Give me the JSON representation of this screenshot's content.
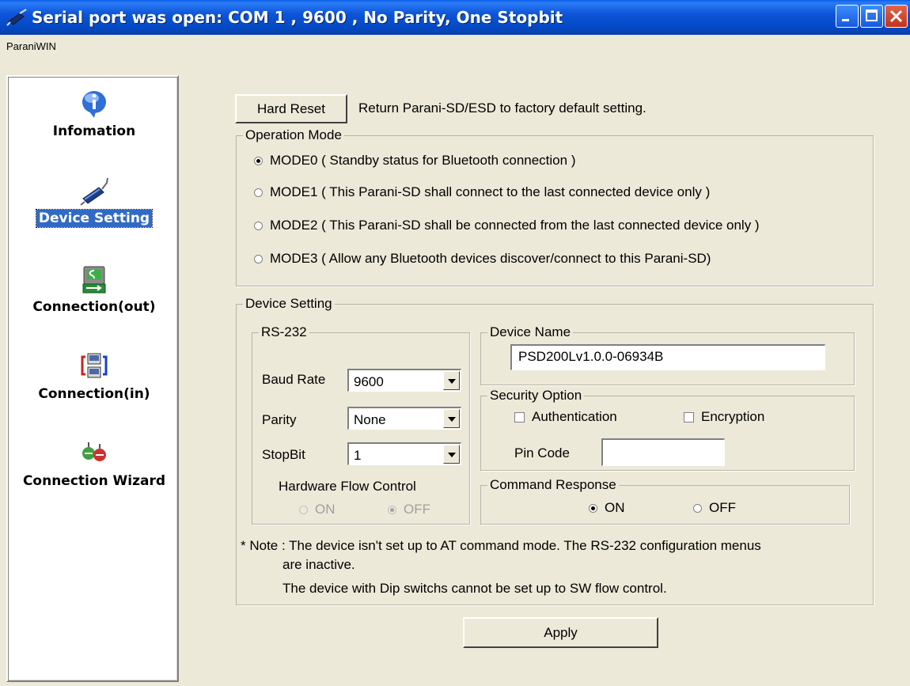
{
  "window": {
    "title": "Serial port was open: COM 1 , 9600 , No Parity, One Stopbit",
    "menu": "ParaniWIN"
  },
  "sidebar": {
    "items": [
      {
        "label": "Infomation",
        "icon": "info-icon",
        "active": false
      },
      {
        "label": "Device Setting",
        "icon": "serial-cable-icon",
        "active": true
      },
      {
        "label": "Connection(out)",
        "icon": "connection-out-icon",
        "active": false
      },
      {
        "label": "Connection(in)",
        "icon": "connection-in-icon",
        "active": false
      },
      {
        "label": "Connection Wizard",
        "icon": "wizard-icon",
        "active": false
      }
    ]
  },
  "main": {
    "hard_reset": {
      "button": "Hard Reset",
      "description": "Return Parani-SD/ESD to factory default setting."
    },
    "operation_mode": {
      "title": "Operation Mode",
      "options": [
        "MODE0 ( Standby status for Bluetooth connection )",
        "MODE1 ( This Parani-SD shall connect to the last connected device only )",
        "MODE2 ( This Parani-SD shall be connected from the last connected device only )",
        "MODE3 ( Allow any Bluetooth devices discover/connect to this Parani-SD)"
      ],
      "selected": 0
    },
    "device_setting": {
      "title": "Device Setting",
      "rs232": {
        "title": "RS-232",
        "baud_label": "Baud Rate",
        "baud_value": "9600",
        "parity_label": "Parity",
        "parity_value": "None",
        "stopbit_label": "StopBit",
        "stopbit_value": "1",
        "flow_label": "Hardware Flow Control",
        "flow_on": "ON",
        "flow_off": "OFF",
        "flow_selected": "OFF"
      },
      "device_name": {
        "title": "Device Name",
        "value": "PSD200Lv1.0.0-06934B"
      },
      "security": {
        "title": "Security Option",
        "authentication": "Authentication",
        "encryption": "Encryption",
        "pin_label": "Pin Code",
        "pin_value": ""
      },
      "command_response": {
        "title": "Command Response",
        "on": "ON",
        "off": "OFF",
        "selected": "ON"
      },
      "note": {
        "line1": "* Note : The device isn't set up to AT command mode. The RS-232 configuration menus",
        "line2": "are inactive.",
        "line3": "The device with Dip switchs cannot be set up to SW flow control."
      }
    },
    "apply": "Apply"
  },
  "colors": {
    "titlebar": "#0349c4",
    "background": "#ece9d8",
    "selection": "#316ac5",
    "close_button": "#c0341c"
  }
}
